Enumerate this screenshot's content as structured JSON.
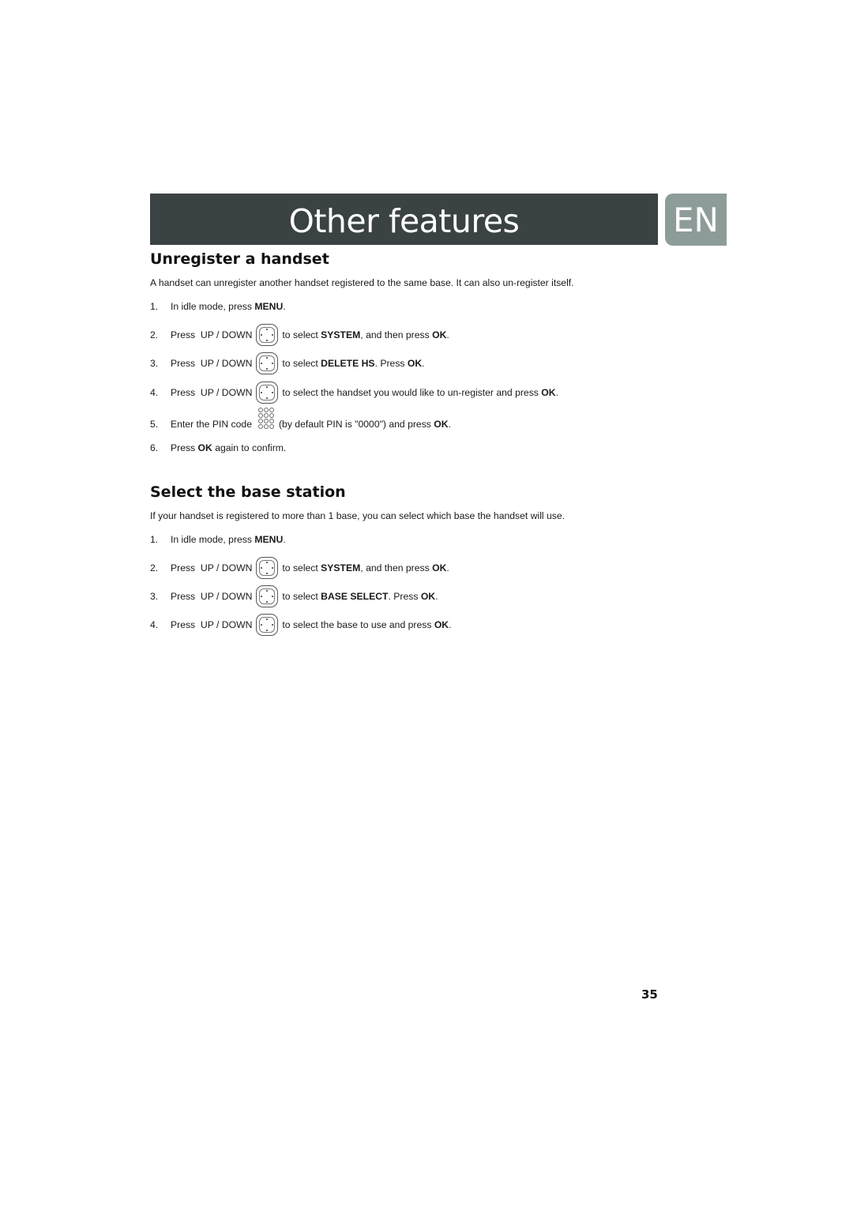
{
  "header": {
    "title": "Other features",
    "language_badge": "EN"
  },
  "sections": [
    {
      "title": "Unregister a handset",
      "intro": "A handset can unregister another handset registered to the same base. It can also un-register itself.",
      "steps": [
        {
          "num": "1.",
          "before": "In idle mode, press ",
          "bold1": "MENU",
          "mid": ".",
          "icon": "",
          "after": "",
          "bold2": "",
          "end": ""
        },
        {
          "num": "2.",
          "before": "Press  UP / DOWN",
          "icon": "nav-key-icon",
          "after": "to select ",
          "bold1": "SYSTEM",
          "mid": ", and then press ",
          "bold2": "OK",
          "end": "."
        },
        {
          "num": "3.",
          "before": "Press  UP / DOWN",
          "icon": "nav-key-icon",
          "after": "to select ",
          "bold1": "DELETE HS",
          "mid": ". Press ",
          "bold2": "OK",
          "end": "."
        },
        {
          "num": "4.",
          "before": "Press  UP / DOWN",
          "icon": "nav-key-icon",
          "after": "to select the handset you would like to un-register and press ",
          "bold1": "OK",
          "mid": ".",
          "bold2": "",
          "end": ""
        },
        {
          "num": "5.",
          "before": "Enter the PIN code",
          "icon": "keypad-icon",
          "after": "(by default PIN is \"0000\") and press ",
          "bold1": "OK",
          "mid": ".",
          "bold2": "",
          "end": ""
        },
        {
          "num": "6.",
          "before": "Press ",
          "bold1": "OK",
          "mid": " again to confirm.",
          "icon": "",
          "after": "",
          "bold2": "",
          "end": ""
        }
      ]
    },
    {
      "title": "Select the base station",
      "intro": "If your handset is registered to more than 1 base, you can select which base the handset will use.",
      "steps": [
        {
          "num": "1.",
          "before": "In idle mode, press ",
          "bold1": "MENU",
          "mid": ".",
          "icon": "",
          "after": "",
          "bold2": "",
          "end": ""
        },
        {
          "num": "2.",
          "before": "Press  UP / DOWN",
          "icon": "nav-key-icon",
          "after": "to select ",
          "bold1": "SYSTEM",
          "mid": ", and then press ",
          "bold2": "OK",
          "end": "."
        },
        {
          "num": "3.",
          "before": "Press  UP / DOWN",
          "icon": "nav-key-icon",
          "after": "to select ",
          "bold1": "BASE SELECT",
          "mid": ". Press ",
          "bold2": "OK",
          "end": "."
        },
        {
          "num": "4.",
          "before": "Press  UP / DOWN",
          "icon": "nav-key-icon",
          "after": "to select the base to use and press ",
          "bold1": "OK",
          "mid": ".",
          "bold2": "",
          "end": ""
        }
      ]
    }
  ],
  "footer": {
    "page_number": "35"
  }
}
